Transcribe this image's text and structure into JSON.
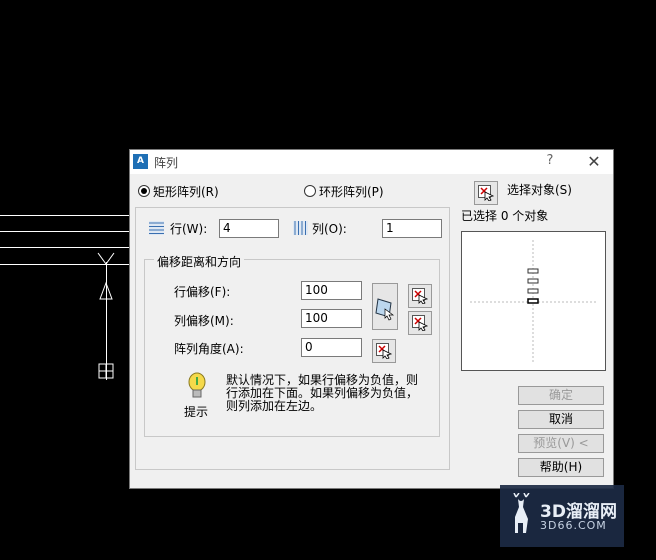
{
  "dialog": {
    "title": "阵列",
    "app_icon_text": "A",
    "help_glyph": "?",
    "close_glyph": "✕",
    "rect_array_label": "矩形阵列(R)",
    "polar_array_label": "环形阵列(P)",
    "rows_label": "行(W):",
    "rows_value": "4",
    "cols_label": "列(O):",
    "cols_value": "1",
    "offset_group_title": "偏移距离和方向",
    "row_offset_label": "行偏移(F):",
    "row_offset_value": "100",
    "col_offset_label": "列偏移(M):",
    "col_offset_value": "100",
    "angle_label": "阵列角度(A):",
    "angle_value": "0",
    "tip_label": "提示",
    "tip_text_1": "默认情况下，如果行偏移为负值，则",
    "tip_text_2": "行添加在下面。如果列偏移为负值，",
    "tip_text_3": "则列添加在左边。",
    "select_objects_label": "选择对象(S)",
    "selected_count_text": "已选择 0 个对象",
    "ok_label": "确定",
    "cancel_label": "取消",
    "preview_label": "预览(V) <",
    "help_label": "帮助(H)"
  },
  "watermark": {
    "text": "3D溜溜网",
    "sub": "3D66.COM"
  },
  "colors": {
    "dialog_bg": "#f0f0f0",
    "canvas_bg": "#000000",
    "cad_lines": "#ffffff"
  }
}
